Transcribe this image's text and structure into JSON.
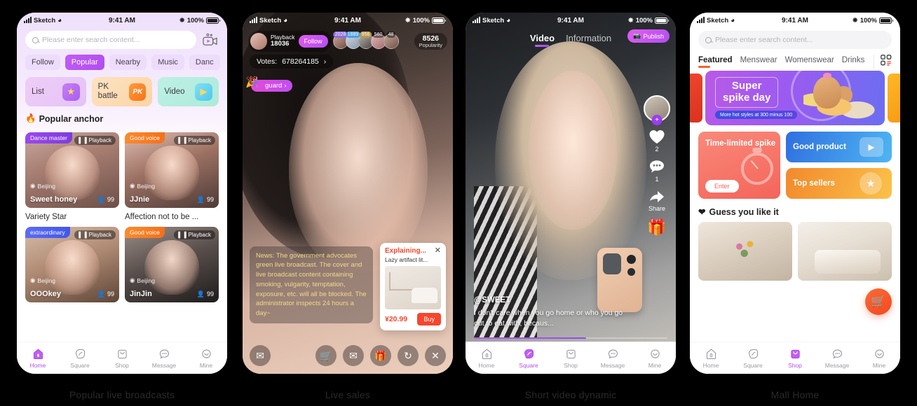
{
  "status_bar": {
    "carrier": "Sketch",
    "time": "9:41 AM",
    "battery": "100%"
  },
  "captions": {
    "s1": "Popular live broadcasts",
    "s2": "Live sales",
    "s3": "Short video dynamic",
    "s4": "Mall Home"
  },
  "screen1": {
    "search_placeholder": "Please enter search content...",
    "tabs": [
      {
        "label": "Follow",
        "active": false
      },
      {
        "label": "Popular",
        "active": true
      },
      {
        "label": "Nearby",
        "active": false
      },
      {
        "label": "Music",
        "active": false
      },
      {
        "label": "Danc",
        "active": false
      }
    ],
    "quick": [
      {
        "label": "List",
        "icon": "trophy-icon"
      },
      {
        "label": "PK battle",
        "icon": "pk-icon"
      },
      {
        "label": "Video",
        "icon": "play-icon"
      }
    ],
    "section_title": "Popular anchor",
    "section_icon": "fire-icon",
    "cards": [
      {
        "tag": "Dance master",
        "tag_color": "purple",
        "playback": "Playback",
        "city": "Beijing",
        "name": "Sweet honey",
        "viewers": "99",
        "title": "Variety Star"
      },
      {
        "tag": "Good voice",
        "tag_color": "orange",
        "playback": "Playback",
        "city": "Beijing",
        "name": "JJnie",
        "viewers": "99",
        "title": "Affection not to be ..."
      },
      {
        "tag": "extraordinary",
        "tag_color": "blue",
        "playback": "Playback",
        "city": "Beijing",
        "name": "OOOkey",
        "viewers": "99",
        "title": ""
      },
      {
        "tag": "Good voice",
        "tag_color": "orange",
        "playback": "Playback",
        "city": "Beijing",
        "name": "JinJin",
        "viewers": "99",
        "title": ""
      }
    ],
    "tabbar": [
      {
        "label": "Home",
        "icon": "home-icon",
        "active": true
      },
      {
        "label": "Square",
        "icon": "square-icon",
        "active": false
      },
      {
        "label": "Shop",
        "icon": "shop-icon",
        "active": false
      },
      {
        "label": "Message",
        "icon": "message-icon",
        "active": false
      },
      {
        "label": "Mine",
        "icon": "mine-icon",
        "active": false
      }
    ]
  },
  "screen2": {
    "anchor_label": "Playback",
    "anchor_value": "18036",
    "follow_label": "Follow",
    "viewers": [
      "2028",
      "1889",
      "956",
      "560",
      "48"
    ],
    "popularity_value": "8526",
    "popularity_label": "Popularity",
    "votes_label": "Votes:",
    "votes_value": "678264185",
    "guard_label": "guard",
    "news_text": "News: The government advocates green live broadcast. The cover and live broadcast content containing smoking, vulgarity, temptation, exposure, etc. will all be blocked. The administrator inspects 24 hours a day~",
    "product": {
      "explaining": "Explaining...",
      "name": "Lazy artifact lit...",
      "price": "¥20.99",
      "buy_label": "Buy",
      "close_icon": "close-icon"
    },
    "actions": [
      {
        "icon": "chat-icon"
      },
      {
        "icon": "cart-icon"
      },
      {
        "icon": "mail-icon"
      },
      {
        "icon": "gift-box-icon"
      },
      {
        "icon": "refresh-icon"
      },
      {
        "icon": "close-icon"
      }
    ]
  },
  "screen3": {
    "tabs": [
      {
        "label": "Video",
        "active": true
      },
      {
        "label": "Information",
        "active": false
      }
    ],
    "publish_label": "Publish",
    "publish_icon": "camera-icon",
    "rail": {
      "like_icon": "heart-icon",
      "like_count": "2",
      "comment_icon": "comment-icon",
      "comment_count": "1",
      "share_icon": "share-icon",
      "share_label": "Share",
      "gift_icon": "gift-icon",
      "plus_icon": "plus-icon"
    },
    "user": "@SWEET",
    "caption": "I don't care when you go home or who you go out to eat with, becaus...",
    "tabbar": [
      {
        "label": "Home",
        "icon": "home-icon",
        "active": false
      },
      {
        "label": "Square",
        "icon": "square-icon",
        "active": true
      },
      {
        "label": "Shop",
        "icon": "shop-icon",
        "active": false
      },
      {
        "label": "Message",
        "icon": "message-icon",
        "active": false
      },
      {
        "label": "Mine",
        "icon": "mine-icon",
        "active": false
      }
    ]
  },
  "screen4": {
    "search_placeholder": "Please enter search content...",
    "tabs": [
      {
        "label": "Featured",
        "active": true
      },
      {
        "label": "Menswear",
        "active": false
      },
      {
        "label": "Womenswear",
        "active": false
      },
      {
        "label": "Drinks",
        "active": false
      }
    ],
    "grid_icon": "category-grid-icon",
    "banner": {
      "title_line1": "Super",
      "title_line2": "spike day",
      "subtitle": "More hot styles at 300 minus 100"
    },
    "promos": {
      "spike_title": "Time-limited spike",
      "spike_button": "Enter",
      "good_product": "Good product",
      "top_sellers": "Top sellers"
    },
    "guess_title": "Guess you like it",
    "guess_icon": "heart-icon",
    "fab_icon": "cart-icon",
    "tabbar": [
      {
        "label": "Home",
        "icon": "home-icon",
        "active": false
      },
      {
        "label": "Square",
        "icon": "square-icon",
        "active": false
      },
      {
        "label": "Shop",
        "icon": "shop-icon",
        "active": true
      },
      {
        "label": "Message",
        "icon": "message-icon",
        "active": false
      },
      {
        "label": "Mine",
        "icon": "mine-icon",
        "active": false
      }
    ]
  },
  "colors": {
    "accent_purple": "#b24ef0",
    "accent_orange": "#f4622c",
    "accent_red": "#f4472d"
  }
}
